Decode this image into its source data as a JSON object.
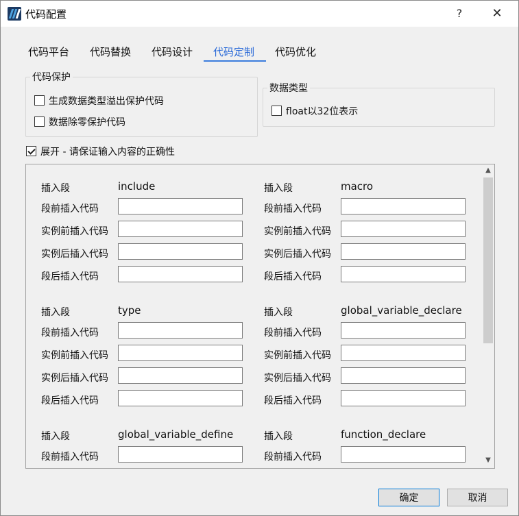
{
  "window": {
    "title": "代码配置",
    "help_label": "?",
    "close_label": "✕"
  },
  "tabs": [
    {
      "label": "代码平台"
    },
    {
      "label": "代码替换"
    },
    {
      "label": "代码设计"
    },
    {
      "label": "代码定制",
      "active": true
    },
    {
      "label": "代码优化"
    }
  ],
  "protection_group": {
    "title": "代码保护",
    "options": [
      {
        "label": "生成数据类型溢出保护代码",
        "checked": false
      },
      {
        "label": "数据除零保护代码",
        "checked": false
      }
    ]
  },
  "datatype_group": {
    "title": "数据类型",
    "options": [
      {
        "label": "float以32位表示",
        "checked": false
      }
    ]
  },
  "expand_option": {
    "label": "展开 - 请保证输入内容的正确性",
    "checked": true
  },
  "field_labels": {
    "segment": "插入段",
    "before_segment": "段前插入代码",
    "before_instance": "实例前插入代码",
    "after_instance": "实例后插入代码",
    "after_segment": "段后插入代码"
  },
  "segments": [
    {
      "name": "include",
      "fields": [
        "",
        "",
        "",
        ""
      ]
    },
    {
      "name": "macro",
      "fields": [
        "",
        "",
        "",
        ""
      ]
    },
    {
      "name": "type",
      "fields": [
        "",
        "",
        "",
        ""
      ]
    },
    {
      "name": "global_variable_declare",
      "fields": [
        "",
        "",
        "",
        ""
      ]
    },
    {
      "name": "global_variable_define",
      "fields": [
        ""
      ]
    },
    {
      "name": "function_declare",
      "fields": [
        ""
      ]
    }
  ],
  "scrollbar": {
    "up_icon": "▲",
    "down_icon": "▼"
  },
  "buttons": {
    "ok": "确定",
    "cancel": "取消"
  },
  "colors": {
    "active_tab": "#2a6ad8",
    "tab_underline": "#3b7ddd",
    "app_icon": "#1c3a63"
  }
}
